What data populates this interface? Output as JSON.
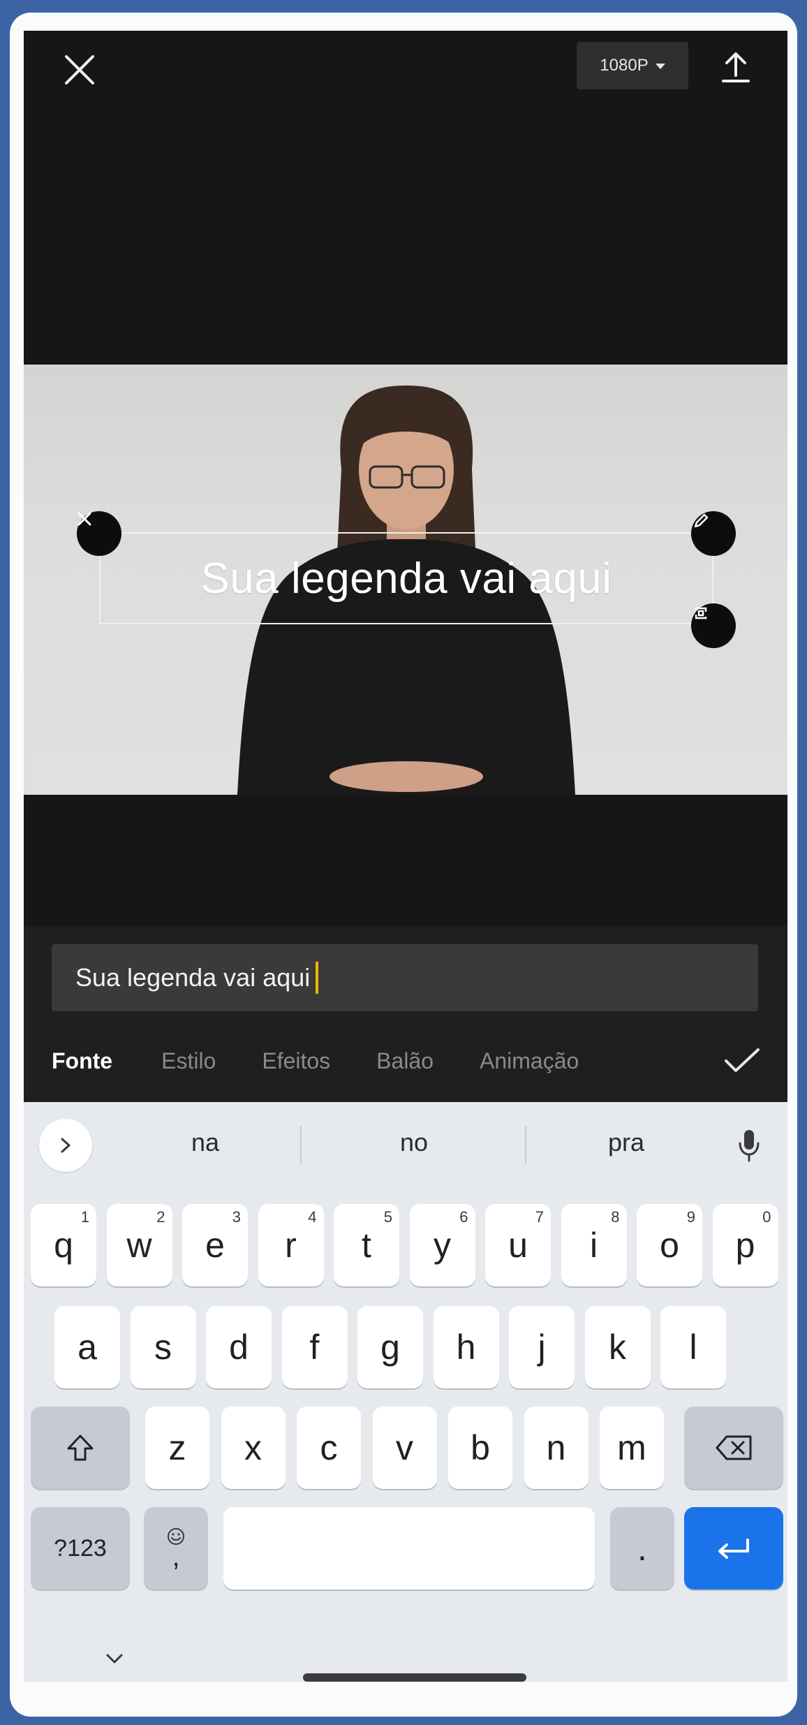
{
  "topbar": {
    "close_icon": "close-icon",
    "resolution_label": "1080P",
    "upload_icon": "upload-icon"
  },
  "video": {
    "overlay_text": "Sua legenda vai aqui"
  },
  "editor": {
    "text_value": "Sua legenda vai aqui",
    "tabs": [
      {
        "label": "Fonte",
        "active": true
      },
      {
        "label": "Estilo",
        "active": false
      },
      {
        "label": "Efeitos",
        "active": false
      },
      {
        "label": "Balão",
        "active": false
      },
      {
        "label": "Animação",
        "active": false
      }
    ]
  },
  "keyboard": {
    "suggestions": [
      "na",
      "no",
      "pra"
    ],
    "row1": [
      {
        "k": "q",
        "s": "1"
      },
      {
        "k": "w",
        "s": "2"
      },
      {
        "k": "e",
        "s": "3"
      },
      {
        "k": "r",
        "s": "4"
      },
      {
        "k": "t",
        "s": "5"
      },
      {
        "k": "y",
        "s": "6"
      },
      {
        "k": "u",
        "s": "7"
      },
      {
        "k": "i",
        "s": "8"
      },
      {
        "k": "o",
        "s": "9"
      },
      {
        "k": "p",
        "s": "0"
      }
    ],
    "row2": [
      "a",
      "s",
      "d",
      "f",
      "g",
      "h",
      "j",
      "k",
      "l"
    ],
    "row3": [
      "z",
      "x",
      "c",
      "v",
      "b",
      "n",
      "m"
    ],
    "symbols_label": "?123",
    "emoji_comma_label": ",",
    "period_label": "."
  },
  "colors": {
    "background": "#3c64a5",
    "accent": "#1a73e8",
    "cursor": "#f5b400"
  }
}
